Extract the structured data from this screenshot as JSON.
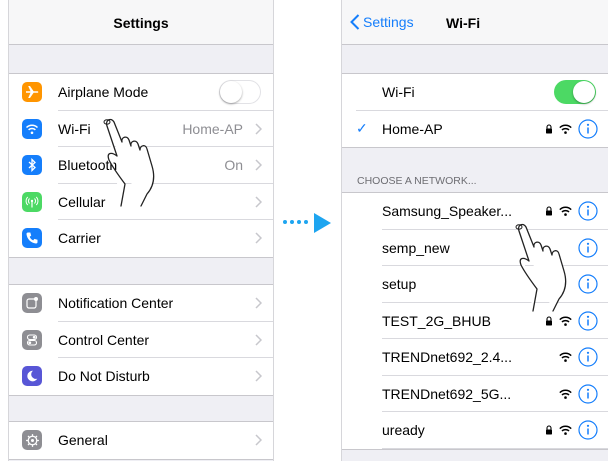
{
  "settings_screen": {
    "title": "Settings",
    "group1": [
      {
        "label": "Airplane Mode",
        "icon": "airplane-icon",
        "color": "#ff9500",
        "control": "toggle-off"
      },
      {
        "label": "Wi-Fi",
        "icon": "wifi-icon",
        "color": "#157efb",
        "value": "Home-AP"
      },
      {
        "label": "Bluetooth",
        "icon": "bluetooth-icon",
        "color": "#157efb",
        "value": "On"
      },
      {
        "label": "Cellular",
        "icon": "cellular-icon",
        "color": "#4cd964",
        "value": ""
      },
      {
        "label": "Carrier",
        "icon": "phone-icon",
        "color": "#157efb",
        "value": ""
      }
    ],
    "group2": [
      {
        "label": "Notification Center",
        "icon": "notification-center-icon",
        "color": "#8e8e93"
      },
      {
        "label": "Control Center",
        "icon": "control-center-icon",
        "color": "#8e8e93"
      },
      {
        "label": "Do Not Disturb",
        "icon": "moon-icon",
        "color": "#5856d6"
      }
    ],
    "group3": [
      {
        "label": "General",
        "icon": "gear-icon",
        "color": "#8e8e93"
      }
    ]
  },
  "wifi_screen": {
    "back_label": "Settings",
    "title": "Wi-Fi",
    "wifi_toggle_label": "Wi-Fi",
    "wifi_toggle_state": "on",
    "connected_network": "Home-AP",
    "section_header": "CHOOSE A NETWORK...",
    "networks": [
      {
        "name": "Samsung_Speaker...",
        "locked": true
      },
      {
        "name": "semp_new",
        "locked": false
      },
      {
        "name": "setup",
        "locked": false
      },
      {
        "name": "TEST_2G_BHUB",
        "locked": true
      },
      {
        "name": "TRENDnet692_2.4...",
        "locked": false
      },
      {
        "name": "TRENDnet692_5G...",
        "locked": false
      },
      {
        "name": "uready",
        "locked": true
      }
    ]
  },
  "colors": {
    "ios_blue": "#157efb",
    "toggle_on": "#4cd964",
    "arrow": "#1ea5f0"
  }
}
